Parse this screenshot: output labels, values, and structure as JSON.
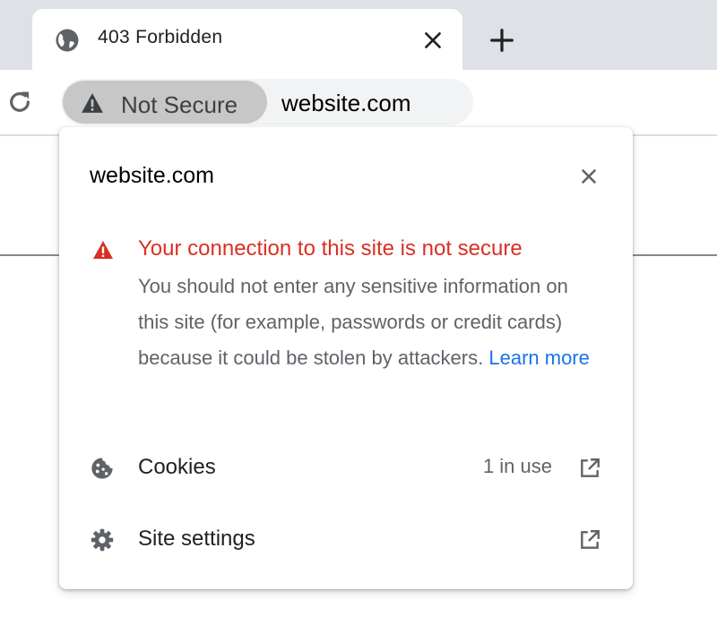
{
  "tab": {
    "title": "403 Forbidden",
    "favicon": "globe-icon",
    "close": "close-icon"
  },
  "newtab": "plus-icon",
  "toolbar": {
    "reload": "reload-icon",
    "security_chip": {
      "label": "Not Secure",
      "icon": "warning-icon"
    },
    "url": "website.com"
  },
  "popup": {
    "site": "website.com",
    "close": "close-icon",
    "warning": {
      "title": "Your connection to this site is not secure",
      "body": "You should not enter any sensitive information on this site (for example, passwords or credit cards) because it could be stolen by attackers.",
      "link": "Learn more"
    },
    "rows": [
      {
        "label": "Cookies",
        "status": "1 in use",
        "icon": "cookie-icon",
        "action": "open-in-new-icon"
      },
      {
        "label": "Site settings",
        "icon": "gear-icon",
        "action": "open-in-new-icon"
      }
    ]
  },
  "colors": {
    "danger": "#d93025",
    "link": "#1a73e8",
    "tabstrip": "#dee1e6",
    "chip": "#c7c7c7",
    "omnibox": "#f1f3f4"
  }
}
